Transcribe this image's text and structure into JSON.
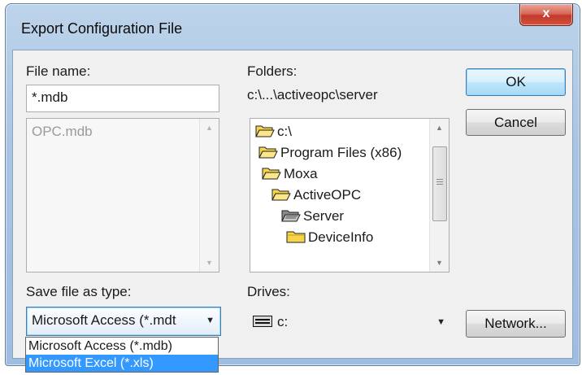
{
  "window": {
    "title": "Export Configuration File",
    "close_glyph": "x"
  },
  "file_name": {
    "label": "File name:",
    "value": "*.mdb",
    "files": [
      "OPC.mdb"
    ]
  },
  "folders": {
    "label": "Folders:",
    "path": "c:\\...\\activeopc\\server",
    "tree": [
      {
        "name": "c:\\",
        "icon": "open-folder-icon"
      },
      {
        "name": "Program Files (x86)",
        "icon": "open-folder-icon"
      },
      {
        "name": "Moxa",
        "icon": "open-folder-icon"
      },
      {
        "name": "ActiveOPC",
        "icon": "open-folder-icon"
      },
      {
        "name": "Server",
        "icon": "open-folder-selected-icon"
      },
      {
        "name": "DeviceInfo",
        "icon": "closed-folder-icon"
      }
    ]
  },
  "save_type": {
    "label": "Save file as type:",
    "value": "Microsoft Access (*.mdt",
    "options": [
      "Microsoft Access (*.mdb)",
      "Microsoft Excel (*.xls)"
    ],
    "highlighted_option": "Microsoft Excel (*.xls)"
  },
  "drives": {
    "label": "Drives:",
    "value": "c:",
    "icon": "drive-icon"
  },
  "buttons": {
    "ok": "OK",
    "cancel": "Cancel",
    "network": "Network..."
  },
  "colors": {
    "selection": "#3399ff",
    "folder": "#f7d54a"
  }
}
